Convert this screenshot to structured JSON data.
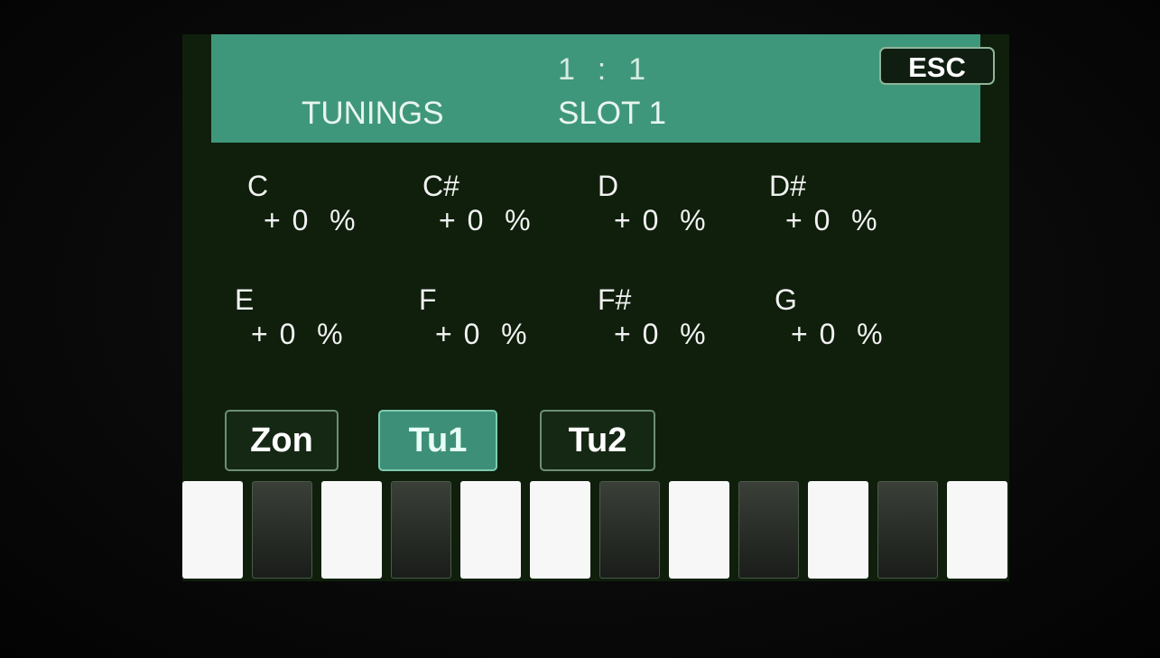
{
  "header": {
    "position": "1  :  1",
    "title": "TUNINGS",
    "slot": "SLOT 1",
    "esc_label": "ESC"
  },
  "notes": [
    {
      "name": "C",
      "value": "+ 0  %"
    },
    {
      "name": "C#",
      "value": "+ 0  %"
    },
    {
      "name": "D",
      "value": "+ 0  %"
    },
    {
      "name": "D#",
      "value": "+ 0  %"
    },
    {
      "name": "E",
      "value": "+ 0  %"
    },
    {
      "name": "F",
      "value": "+ 0  %"
    },
    {
      "name": "F#",
      "value": "+ 0  %"
    },
    {
      "name": "G",
      "value": "+ 0  %"
    }
  ],
  "tabs": [
    {
      "label": "Zon",
      "active": false
    },
    {
      "label": "Tu1",
      "active": true
    },
    {
      "label": "Tu2",
      "active": false
    }
  ],
  "keyboard": [
    "white",
    "black",
    "white",
    "black",
    "white",
    "white",
    "black",
    "white",
    "black",
    "white",
    "black",
    "white"
  ],
  "colors": {
    "header_bg": "#3f977b",
    "screen_bg": "#0f1f0c",
    "active_tab": "#3d8f78"
  }
}
